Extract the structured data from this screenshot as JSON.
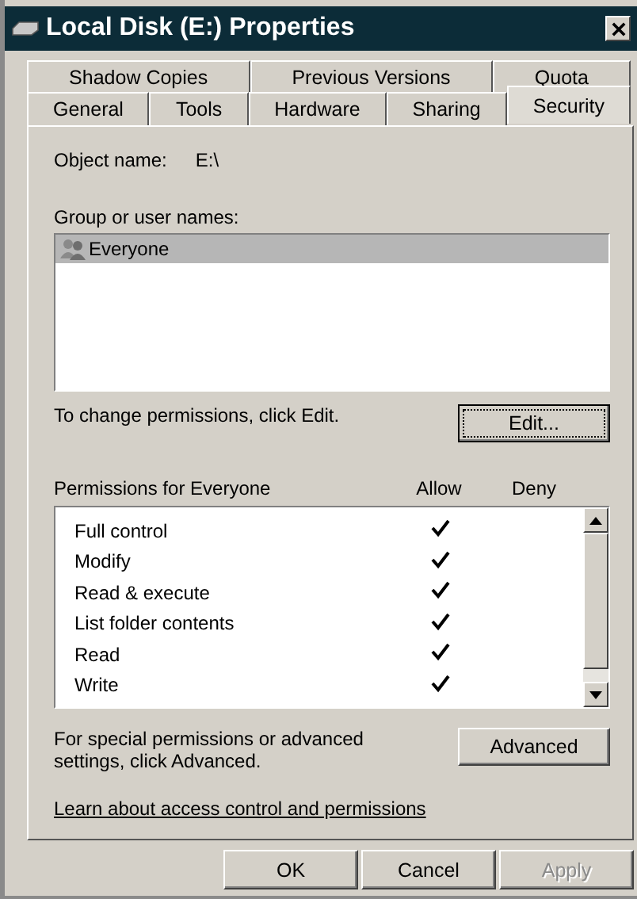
{
  "window": {
    "title": "Local Disk (E:) Properties"
  },
  "tab_rows": [
    {
      "tabs": [
        {
          "label": "Shadow Copies",
          "selected": false
        },
        {
          "label": "Previous Versions",
          "selected": false
        },
        {
          "label": "Quota",
          "selected": false
        }
      ]
    },
    {
      "tabs": [
        {
          "label": "General",
          "selected": false
        },
        {
          "label": "Tools",
          "selected": false
        },
        {
          "label": "Hardware",
          "selected": false
        },
        {
          "label": "Sharing",
          "selected": false
        },
        {
          "label": "Security",
          "selected": true
        }
      ]
    }
  ],
  "object_name": {
    "label": "Object name:",
    "value": "E:\\"
  },
  "groups": {
    "label": "Group or user names:",
    "items": [
      {
        "name": "Everyone",
        "selected": true
      }
    ]
  },
  "edit_hint": "To change permissions, click Edit.",
  "edit_button": "Edit...",
  "permissions": {
    "label": "Permissions for Everyone",
    "columns": [
      "Allow",
      "Deny"
    ],
    "rows": [
      {
        "name": "Full control",
        "allow": true
      },
      {
        "name": "Modify",
        "allow": true
      },
      {
        "name": "Read & execute",
        "allow": true
      },
      {
        "name": "List folder contents",
        "allow": true
      },
      {
        "name": "Read",
        "allow": true
      },
      {
        "name": "Write",
        "allow": true
      }
    ]
  },
  "advanced_hint": "For special permissions or advanced settings, click Advanced.",
  "advanced_button": "Advanced",
  "help_link": "Learn about access control and permissions",
  "buttons": [
    {
      "label": "OK",
      "disabled": false
    },
    {
      "label": "Cancel",
      "disabled": false
    },
    {
      "label": "Apply",
      "disabled": true
    }
  ]
}
